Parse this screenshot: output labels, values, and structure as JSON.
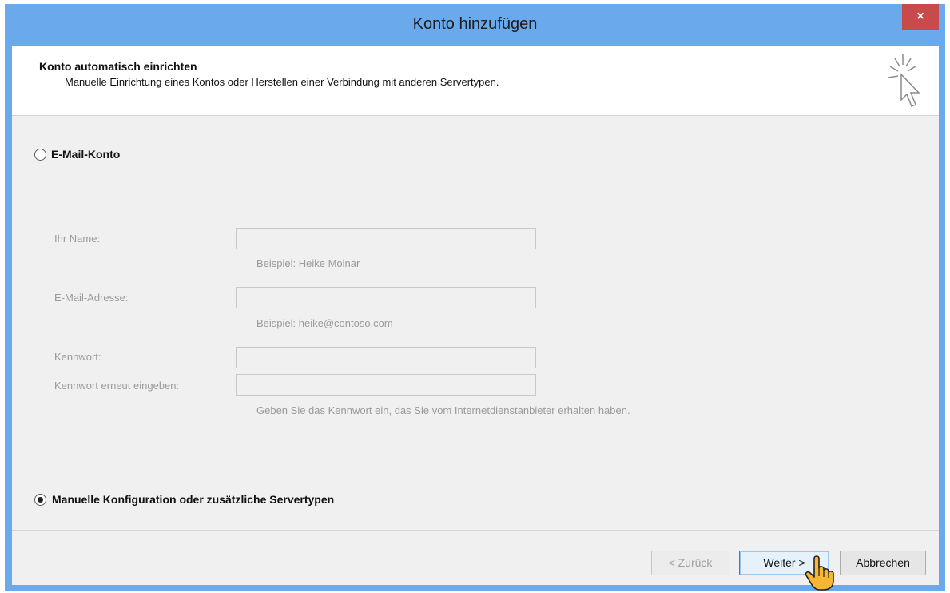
{
  "window": {
    "title": "Konto hinzufügen",
    "close_glyph": "×"
  },
  "header": {
    "title": "Konto automatisch einrichten",
    "subtitle": "Manuelle Einrichtung eines Kontos oder Herstellen einer Verbindung mit anderen Servertypen.",
    "icon": "wizard-cursor-icon"
  },
  "options": {
    "email_account": {
      "label": "E-Mail-Konto",
      "selected": false
    },
    "manual_config": {
      "label": "Manuelle Konfiguration oder zusätzliche Servertypen",
      "selected": true
    }
  },
  "form": {
    "name_label": "Ihr Name:",
    "name_hint": "Beispiel: Heike Molnar",
    "email_label": "E-Mail-Adresse:",
    "email_hint": "Beispiel: heike@contoso.com",
    "password_label": "Kennwort:",
    "password_repeat_label": "Kennwort erneut eingeben:",
    "password_hint": "Geben Sie das Kennwort ein, das Sie vom Internetdienstanbieter erhalten haben."
  },
  "buttons": {
    "back": "< Zurück",
    "next": "Weiter >",
    "cancel": "Abbrechen"
  },
  "colors": {
    "titlebar": "#6aa9ec",
    "close": "#c84a4a",
    "dialog_bg": "#f0f0f0"
  }
}
